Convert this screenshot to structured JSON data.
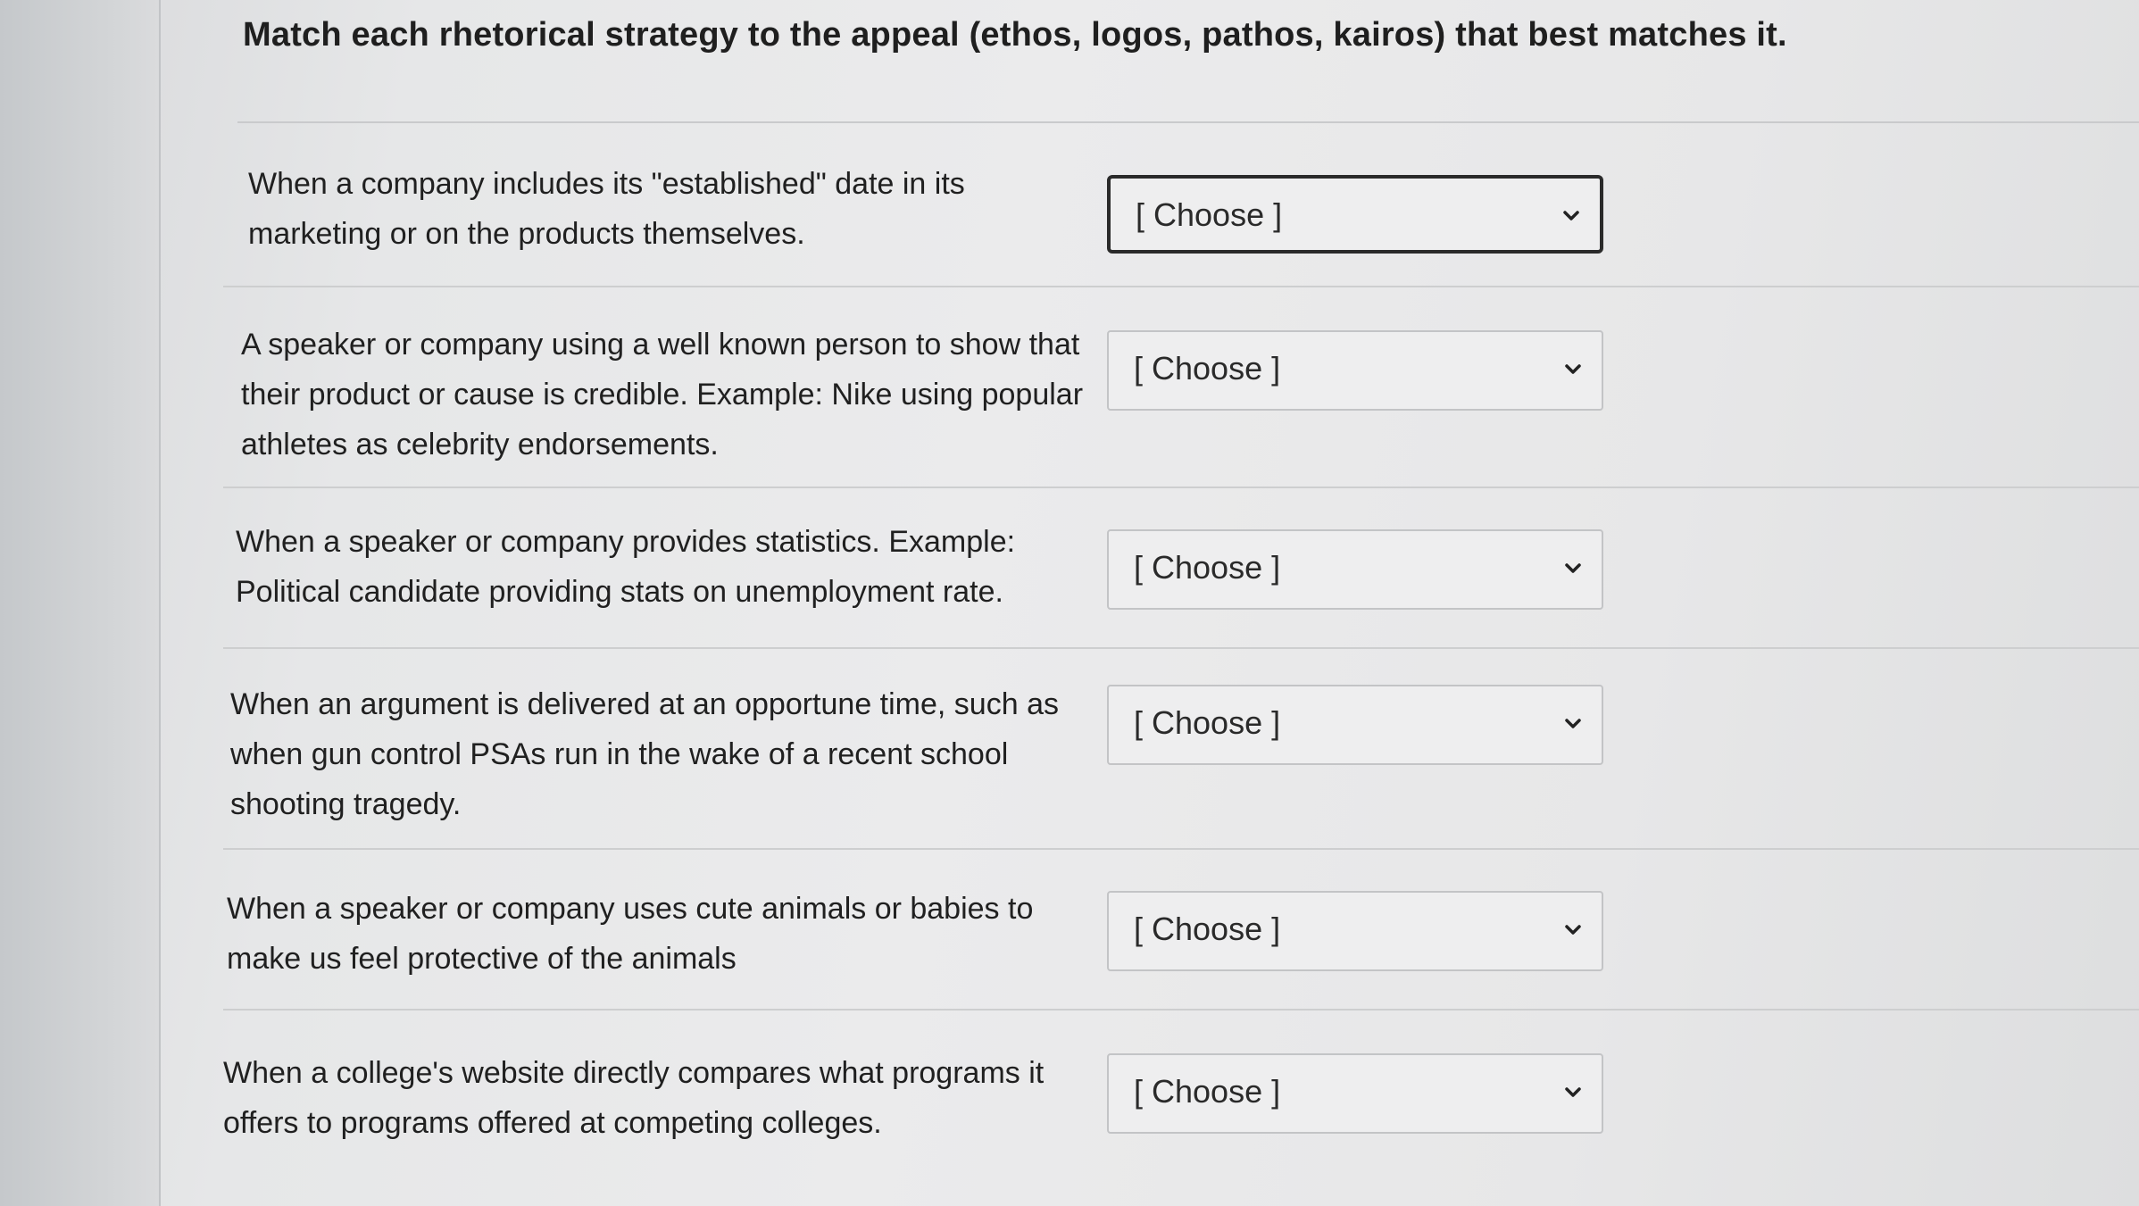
{
  "quiz": {
    "instruction": "Match each rhetorical strategy to the appeal (ethos, logos, pathos, kairos) that best matches it."
  },
  "rows": [
    {
      "prompt": "When a company includes its \"established\" date in its marketing or on the products themselves.",
      "selected": "[ Choose ]"
    },
    {
      "prompt": "A speaker or company using a well known person to show that their product or cause is credible. Example: Nike using popular athletes as celebrity endorsements.",
      "selected": "[ Choose ]"
    },
    {
      "prompt": "When a speaker or company provides statistics. Example: Political candidate providing stats on unemployment rate.",
      "selected": "[ Choose ]"
    },
    {
      "prompt": "When an argument is delivered at an opportune time, such as when gun control PSAs run in the wake of a recent school shooting tragedy.",
      "selected": "[ Choose ]"
    },
    {
      "prompt": "When a speaker or company uses cute animals or babies to make us feel protective of the animals",
      "selected": "[ Choose ]"
    },
    {
      "prompt": "When a college's website directly compares what programs it offers to programs offered at competing colleges.",
      "selected": "[ Choose ]"
    }
  ],
  "icons": {
    "dropdown": "chevron-down-icon"
  }
}
